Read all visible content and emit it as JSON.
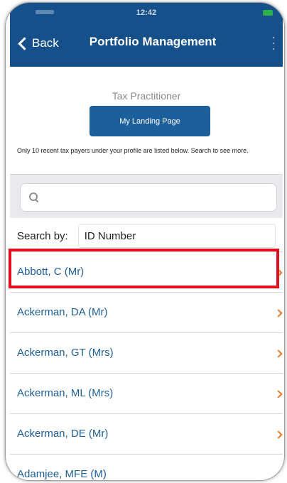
{
  "status_bar": {
    "time": "12:42"
  },
  "nav": {
    "back_label": "Back",
    "title": "Portfolio Management"
  },
  "role_label": "Tax Practitioner",
  "landing_button": "My Landing Page",
  "info_text": "Only 10 recent tax payers under your profile are listed below. Search to see more.",
  "search": {
    "placeholder": "",
    "value": ""
  },
  "search_by": {
    "label": "Search by:",
    "value": "ID Number"
  },
  "taxpayers": [
    {
      "name": "Abbott, C (Mr)"
    },
    {
      "name": "Ackerman, DA (Mr)"
    },
    {
      "name": "Ackerman, GT (Mrs)"
    },
    {
      "name": "Ackerman, ML (Mrs)"
    },
    {
      "name": "Ackerman, DE (Mr)"
    },
    {
      "name": "Adamjee, MFE (M)"
    }
  ],
  "colors": {
    "navbar": "#16508a",
    "button": "#1d5f9a",
    "link": "#1f5f98",
    "chevron": "#e87722",
    "highlight": "#e0101c"
  }
}
